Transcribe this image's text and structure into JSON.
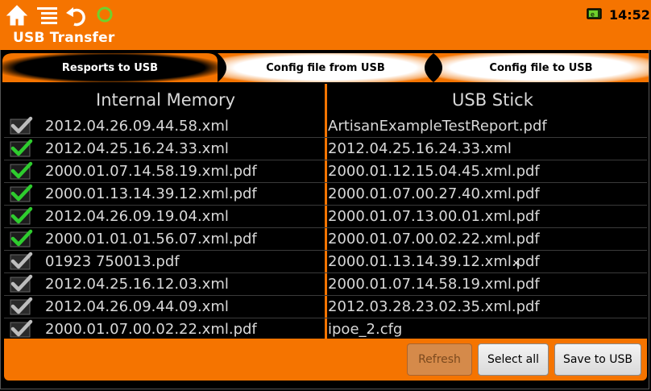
{
  "statusbar": {
    "time": "14:52"
  },
  "app": {
    "title": "USB Transfer"
  },
  "tabs": [
    {
      "label": "Resports to USB",
      "active": true
    },
    {
      "label": "Config file from USB",
      "active": false
    },
    {
      "label": "Config file to USB",
      "active": false
    }
  ],
  "left": {
    "header": "Internal Memory",
    "items": [
      {
        "name": "2012.04.26.09.44.58.xml",
        "checked": false
      },
      {
        "name": "2012.04.25.16.24.33.xml",
        "checked": true
      },
      {
        "name": "2000.01.07.14.58.19.xml.pdf",
        "checked": true
      },
      {
        "name": "2000.01.13.14.39.12.xml.pdf",
        "checked": true
      },
      {
        "name": "2012.04.26.09.19.04.xml",
        "checked": true
      },
      {
        "name": "2000.01.01.01.56.07.xml.pdf",
        "checked": true
      },
      {
        "name": "01923 750013.pdf",
        "checked": false
      },
      {
        "name": "2012.04.25.16.12.03.xml",
        "checked": false
      },
      {
        "name": "2012.04.26.09.44.09.xml",
        "checked": false
      },
      {
        "name": "2000.01.07.00.02.22.xml.pdf",
        "checked": false
      }
    ]
  },
  "right": {
    "header": "USB Stick",
    "items": [
      "ArtisanExampleTestReport.pdf",
      "2012.04.25.16.24.33.xml",
      "2000.01.12.15.04.45.xml.pdf",
      "2000.01.07.00.27.40.xml.pdf",
      "2000.01.07.13.00.01.xml.pdf",
      "2000.01.07.00.02.22.xml.pdf",
      "2000.01.13.14.39.12.xml.pdf",
      "2000.01.07.14.58.19.xml.pdf",
      "2012.03.28.23.02.35.xml.pdf",
      "ipoe_2.cfg"
    ]
  },
  "buttons": {
    "refresh": "Refresh",
    "select_all": "Select all",
    "save": "Save to USB"
  },
  "colors": {
    "accent": "#f57400",
    "check_on": "#2ecc2e",
    "check_off": "#bdbdbd"
  },
  "icons": [
    "home-icon",
    "menu-list-icon",
    "undo-icon",
    "circle-icon",
    "battery-icon",
    "checkmark-icon"
  ]
}
